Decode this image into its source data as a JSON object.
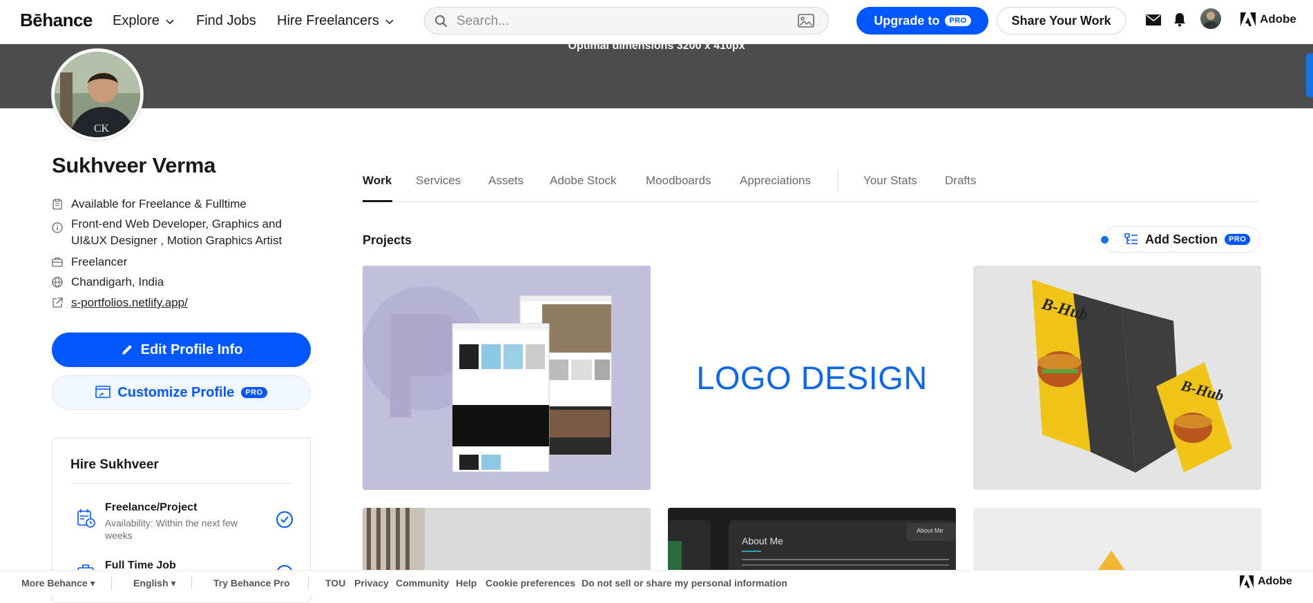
{
  "nav": {
    "logo": "Bēhance",
    "explore": "Explore",
    "find_jobs": "Find Jobs",
    "hire_freelancers": "Hire Freelancers",
    "search_placeholder": "Search...",
    "upgrade_label": "Upgrade to",
    "pro_badge": "PRO",
    "share_label": "Share Your Work",
    "adobe_label": "Adobe"
  },
  "banner": {
    "text": "Optimal dimensions 3200 x 410px",
    "color": "#4c4c4c"
  },
  "profile": {
    "name": "Sukhveer Verma",
    "availability": "Available for Freelance & Fulltime",
    "headline_line1": "Front-end Web Developer, Graphics and",
    "headline_line2": "UI&UX Designer , Motion Graphics Artist",
    "occupation": "Freelancer",
    "location": "Chandigarh, India",
    "website": "s-portfolios.netlify.app/",
    "edit_label": "Edit Profile Info",
    "customize_label": "Customize Profile"
  },
  "hire": {
    "title": "Hire Sukhveer",
    "items": [
      {
        "title": "Freelance/Project",
        "subtitle": "Availability: Within the next few weeks"
      },
      {
        "title": "Full Time Job",
        "subtitle": ""
      }
    ]
  },
  "tabs": [
    "Work",
    "Services",
    "Assets",
    "Adobe Stock",
    "Moodboards",
    "Appreciations",
    "Your Stats",
    "Drafts"
  ],
  "projects": {
    "heading": "Projects",
    "add_section_label": "Add Section",
    "cards": [
      {
        "label": ""
      },
      {
        "label": "LOGO DESIGN"
      },
      {
        "label": "B-Hub"
      },
      {
        "label": ""
      },
      {
        "label": "About Me",
        "sub": "About Me"
      },
      {
        "label": ""
      }
    ]
  },
  "footer": {
    "more_behance": "More Behance",
    "language": "English",
    "try_pro": "Try Behance Pro",
    "links": [
      "TOU",
      "Privacy",
      "Community",
      "Help",
      "Cookie preferences",
      "Do not sell or share my personal information"
    ],
    "adobe": "Adobe"
  },
  "colors": {
    "accent": "#0057ff",
    "banner": "#4c4c4c"
  }
}
